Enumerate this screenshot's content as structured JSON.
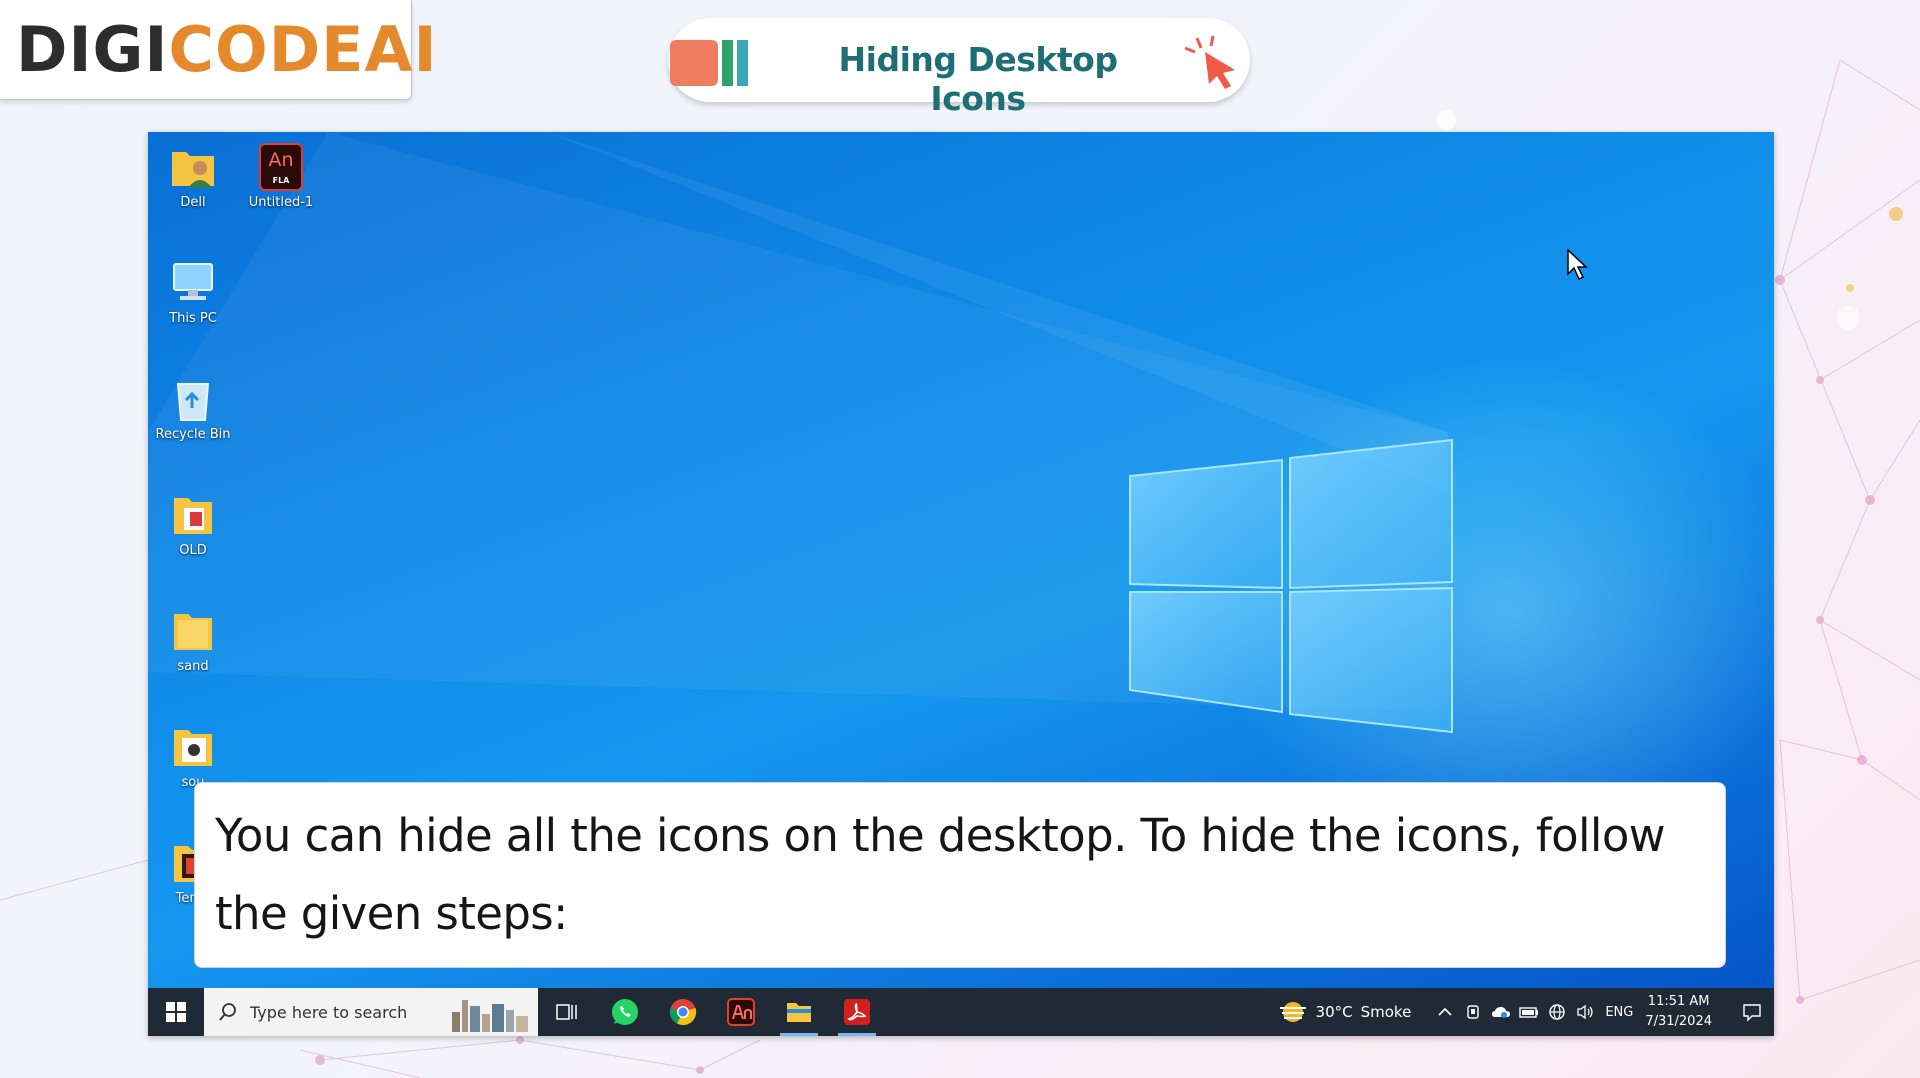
{
  "brand": {
    "logo_part1": "DIGI",
    "logo_part2": "CODE",
    "logo_part3": " AI"
  },
  "header": {
    "title": "Hiding Desktop Icons"
  },
  "desktop": {
    "icons": [
      {
        "label": "Dell",
        "icon": "user-folder-icon"
      },
      {
        "label": "Untitled-1",
        "icon": "animate-fla-icon",
        "glyph_main": "An",
        "glyph_sub": "FLA"
      },
      {
        "label": "This PC",
        "icon": "computer-icon"
      },
      {
        "label": "Recycle Bin",
        "icon": "recycle-bin-icon"
      },
      {
        "label": "OLD",
        "icon": "folder-icon"
      },
      {
        "label": "sand",
        "icon": "folder-icon"
      },
      {
        "label": "sou",
        "icon": "folder-icon"
      },
      {
        "label": "Temp",
        "icon": "folder-icon"
      }
    ]
  },
  "caption": {
    "text": "You can hide all the icons on the desktop. To hide the icons, follow the given steps:"
  },
  "taskbar": {
    "search_placeholder": "Type here to search",
    "apps": [
      "task-view-icon",
      "whatsapp-icon",
      "chrome-icon",
      "animate-icon",
      "file-explorer-icon",
      "acrobat-icon"
    ],
    "weather": {
      "temp": "30°C",
      "condition": "Smoke"
    },
    "language": "ENG",
    "time": "11:51 AM",
    "date": "7/31/2024"
  },
  "colors": {
    "accent_orange": "#e58a2c",
    "title_teal": "#1d6f75",
    "desktop_blue": "#0f8be8",
    "taskbar": "#1f2a36"
  }
}
